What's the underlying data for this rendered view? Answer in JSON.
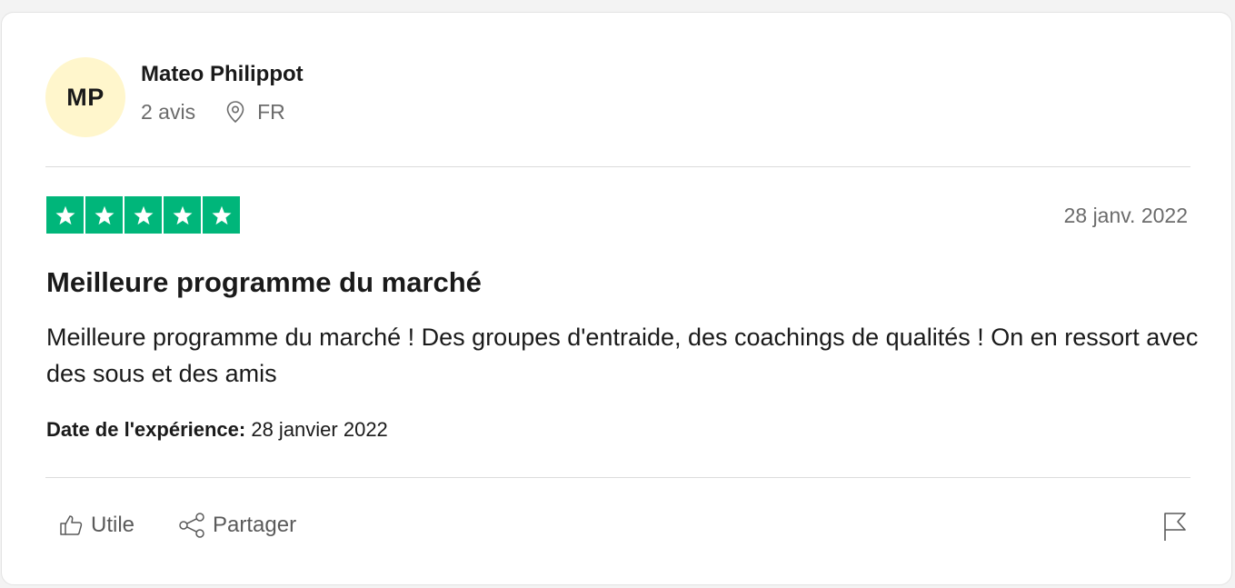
{
  "reviewer": {
    "initials": "MP",
    "name": "Mateo Philippot",
    "review_count": "2 avis",
    "country": "FR",
    "avatar_color": "#fff6cc"
  },
  "review": {
    "rating": 5,
    "star_color": "#00b67a",
    "date": "28 janv. 2022",
    "title": "Meilleure programme du marché",
    "body": "Meilleure programme du marché ! Des groupes d'entraide, des coachings de qualités ! On en ressort avec des sous et des amis",
    "experience_label": "Date de l'expérience:",
    "experience_date": "28 janvier 2022"
  },
  "actions": {
    "useful_label": "Utile",
    "share_label": "Partager",
    "icons": [
      "thumbs-up-icon",
      "share-icon",
      "flag-icon"
    ]
  }
}
